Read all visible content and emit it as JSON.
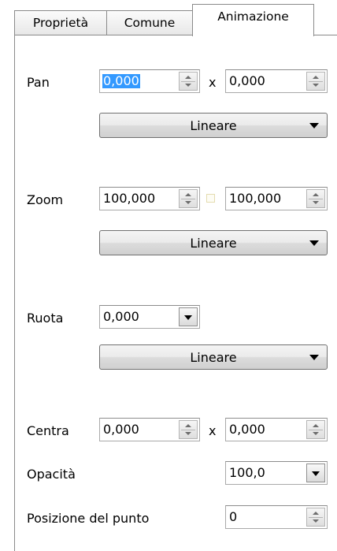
{
  "tabs": [
    {
      "label": "Proprietà",
      "active": false
    },
    {
      "label": "Comune",
      "active": false
    },
    {
      "label": "Animazione",
      "active": true
    }
  ],
  "pan": {
    "label": "Pan",
    "x_value": "0,000",
    "separator": "x",
    "y_value": "0,000",
    "interpolation": "Lineare"
  },
  "zoom": {
    "label": "Zoom",
    "x_value": "100,000",
    "link_checked": false,
    "y_value": "100,000",
    "interpolation": "Lineare"
  },
  "ruota": {
    "label": "Ruota",
    "value": "0,000",
    "interpolation": "Lineare"
  },
  "centra": {
    "label": "Centra",
    "x_value": "0,000",
    "separator": "x",
    "y_value": "0,000"
  },
  "opacita": {
    "label": "Opacità",
    "value": "100,0"
  },
  "posizione": {
    "label": "Posizione del punto",
    "value": "0"
  },
  "colors": {
    "selection": "#3399ff",
    "border": "#8a8a8a",
    "checkbox_border": "#e4dcb0"
  }
}
